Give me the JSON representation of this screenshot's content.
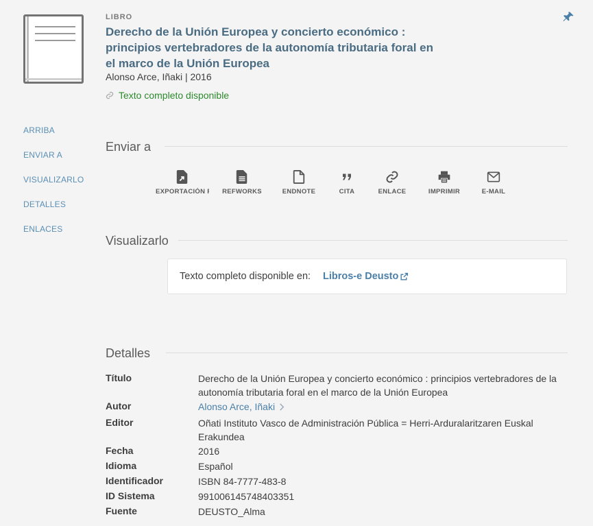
{
  "record": {
    "type": "LIBRO",
    "title": "Derecho de la Unión Europea y concierto económico : principios vertebradores de la autonomía tributaria foral en el marco de la Unión Europea",
    "author_line": "Alonso Arce, Iñaki | 2016",
    "availability": "Texto completo disponible"
  },
  "nav": {
    "items": [
      "ARRIBA",
      "ENVIAR A",
      "VISUALIZARLO",
      "DETALLES",
      "ENLACES"
    ]
  },
  "send_to": {
    "title": "Enviar a",
    "actions": [
      {
        "label": "EXPORTACIÓN R",
        "icon": "export-file-icon"
      },
      {
        "label": "REFWORKS",
        "icon": "document-icon"
      },
      {
        "label": "ENDNOTE",
        "icon": "file-outline-icon"
      },
      {
        "label": "CITA",
        "icon": "quote-icon"
      },
      {
        "label": "ENLACE",
        "icon": "link-icon"
      },
      {
        "label": "IMPRIMIR",
        "icon": "printer-icon"
      },
      {
        "label": "E-MAIL",
        "icon": "mail-icon"
      }
    ]
  },
  "view_it": {
    "title": "Visualizarlo",
    "text": "Texto completo disponible en:",
    "link": "Libros-e Deusto"
  },
  "details": {
    "title": "Detalles",
    "rows": [
      {
        "label": "Título",
        "value": "Derecho de la Unión Europea y concierto económico : principios vertebradores de la autonomía tributaria foral en el marco de la Unión Europea"
      },
      {
        "label": "Autor",
        "value": "Alonso Arce, Iñaki"
      },
      {
        "label": "Editor",
        "value": "Oñati Instituto Vasco de Administración Pública = Herri-Arduralaritzaren Euskal Erakundea"
      },
      {
        "label": "Fecha",
        "value": "2016"
      },
      {
        "label": "Idioma",
        "value": "Español"
      },
      {
        "label": "Identificador",
        "value": "ISBN 84-7777-483-8"
      },
      {
        "label": "ID Sistema",
        "value": "991006145748403351"
      },
      {
        "label": "Fuente",
        "value": "DEUSTO_Alma"
      }
    ]
  },
  "colors": {
    "link": "#4a7fa8",
    "title": "#4a6c83",
    "available": "#2c8a2c",
    "nav": "#5a8fb5"
  }
}
